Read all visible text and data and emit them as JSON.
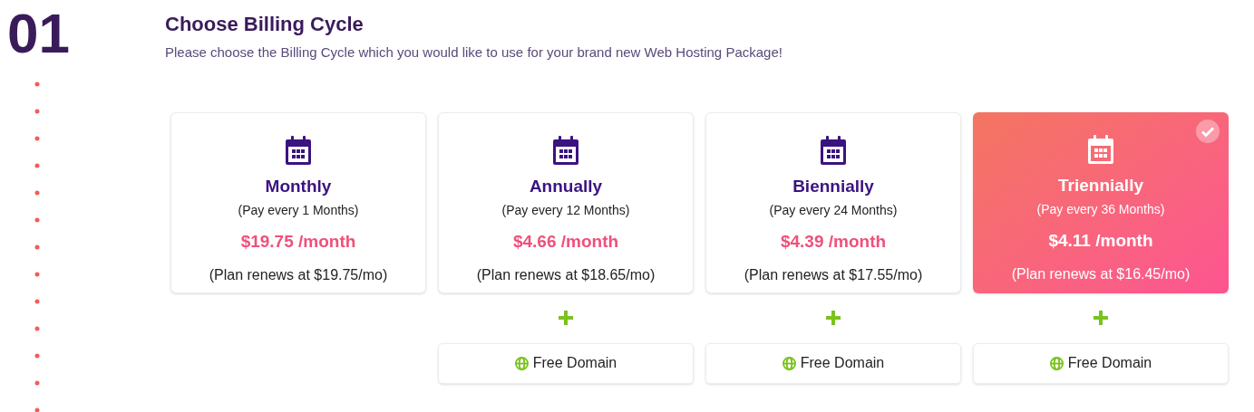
{
  "step": {
    "number": "01",
    "title": "Choose Billing Cycle",
    "subtitle": "Please choose the Billing Cycle which you would like to use for your brand new Web Hosting Package!"
  },
  "cycles": [
    {
      "name": "Monthly",
      "period": "(Pay every 1 Months)",
      "price": "$19.75 /month",
      "renewal": "(Plan renews at $19.75/mo)",
      "selected": false
    },
    {
      "name": "Annually",
      "period": "(Pay every 12 Months)",
      "price": "$4.66 /month",
      "renewal": "(Plan renews at $18.65/mo)",
      "selected": false,
      "addon": "Free Domain"
    },
    {
      "name": "Biennially",
      "period": "(Pay every 24 Months)",
      "price": "$4.39 /month",
      "renewal": "(Plan renews at $17.55/mo)",
      "selected": false,
      "addon": "Free Domain"
    },
    {
      "name": "Triennially",
      "period": "(Pay every 36 Months)",
      "price": "$4.11 /month",
      "renewal": "(Plan renews at $16.45/mo)",
      "selected": true,
      "addon": "Free Domain"
    }
  ]
}
